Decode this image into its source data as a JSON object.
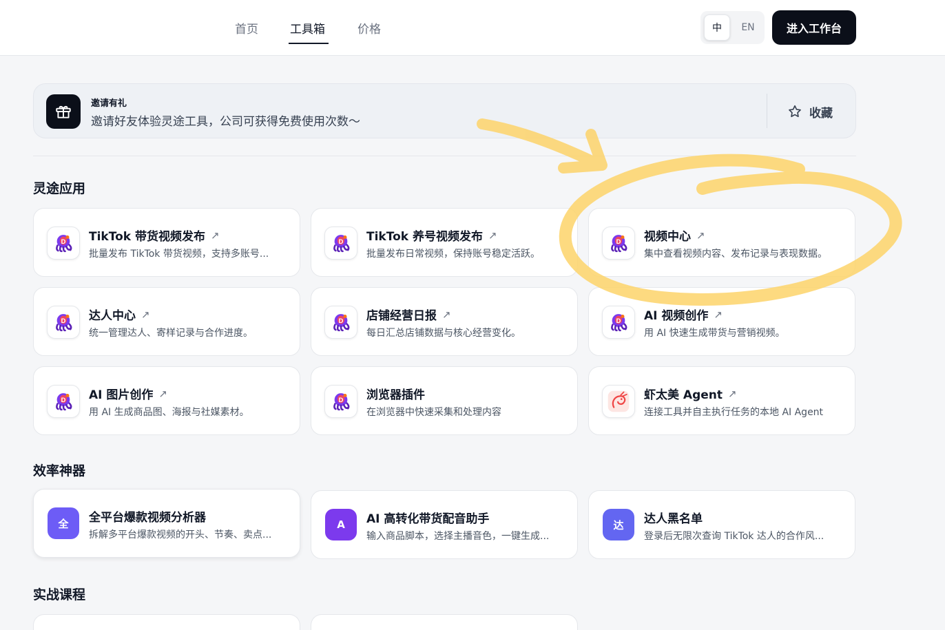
{
  "nav": {
    "links": [
      {
        "label": "首页",
        "active": false
      },
      {
        "label": "工具箱",
        "active": true
      },
      {
        "label": "价格",
        "active": false
      }
    ],
    "lang": {
      "zh": "中",
      "en": "EN",
      "selected": "zh"
    },
    "cta_label": "进入工作台"
  },
  "invite": {
    "title": "邀请有礼",
    "desc": "邀请好友体验灵途工具，公司可获得免费使用次数～",
    "fav_label": "收藏",
    "icon": "gift-icon"
  },
  "sections": [
    {
      "title": "灵途应用",
      "cards": [
        {
          "title": "TikTok 带货视频发布",
          "desc": "批量发布 TikTok 带货视频，支持多账号...",
          "icon": "octopus-logo-icon",
          "external": true
        },
        {
          "title": "TikTok 养号视频发布",
          "desc": "批量发布日常视频，保持账号稳定活跃。",
          "icon": "octopus-logo-icon",
          "external": true
        },
        {
          "title": "视频中心",
          "desc": "集中查看视频内容、发布记录与表现数据。",
          "icon": "octopus-logo-icon",
          "external": true
        },
        {
          "title": "达人中心",
          "desc": "统一管理达人、寄样记录与合作进度。",
          "icon": "octopus-logo-icon",
          "external": true
        },
        {
          "title": "店铺经营日报",
          "desc": "每日汇总店铺数据与核心经营变化。",
          "icon": "octopus-logo-icon",
          "external": true
        },
        {
          "title": "AI 视频创作",
          "desc": "用 AI 快速生成带货与营销视频。",
          "icon": "octopus-logo-icon",
          "external": true
        },
        {
          "title": "AI 图片创作",
          "desc": "用 AI 生成商品图、海报与社媒素材。",
          "icon": "octopus-logo-icon",
          "external": true
        },
        {
          "title": "浏览器插件",
          "desc": "在浏览器中快速采集和处理内容",
          "icon": "octopus-logo-icon",
          "external": false
        },
        {
          "title": "虾太美 Agent",
          "desc": "连接工具并自主执行任务的本地 AI Agent",
          "icon": "shrimp-logo-icon",
          "external": true
        }
      ]
    },
    {
      "title": "效率神器",
      "cards": [
        {
          "title": "全平台爆款视频分析器",
          "desc": "拆解多平台爆款视频的开头、节奏、卖点...",
          "badge": "全",
          "badge_color": "#6d5cf6"
        },
        {
          "title": "AI 高转化带货配音助手",
          "desc": "输入商品脚本，选择主播音色，一键生成...",
          "badge": "A",
          "badge_color": "#7c3aed"
        },
        {
          "title": "达人黑名单",
          "desc": "登录后无限次查询 TikTok 达人的合作风...",
          "badge": "达",
          "badge_color": "#6366f1"
        }
      ]
    },
    {
      "title": "实战课程",
      "cards": []
    }
  ],
  "arrow_glyph": "↗",
  "colors": {
    "annotation": "#fdd36a",
    "cta_bg": "#0b0f19"
  }
}
